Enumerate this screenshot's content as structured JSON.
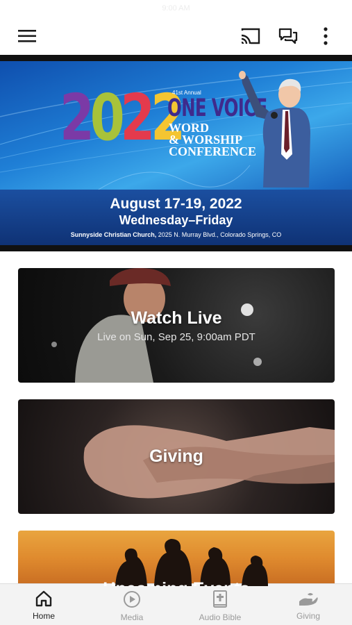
{
  "status_bar": {
    "time": "9:00 AM"
  },
  "app_bar": {
    "menu_icon": "hamburger-menu-icon",
    "cast_icon": "cast-icon",
    "chat_icon": "chat-bubbles-icon",
    "more_icon": "more-vertical-icon"
  },
  "banner": {
    "year": "2022",
    "annual": "41st Annual",
    "name": "ONE VOICE",
    "line1": "WORD",
    "line2": "& WORSHIP",
    "line3": "CONFERENCE",
    "dates": "August 17-19, 2022",
    "days": "Wednesday–Friday",
    "venue_name": "Sunnyside Christian Church,",
    "venue_address": " 2025 N. Murray Blvd., Colorado Springs, CO"
  },
  "cards": [
    {
      "title": "Watch Live",
      "subtitle": "Live on Sun, Sep 25, 9:00am PDT"
    },
    {
      "title": "Giving"
    },
    {
      "title": "Upcoming Events"
    }
  ],
  "tabs": [
    {
      "label": "Home",
      "icon": "home-icon",
      "active": true
    },
    {
      "label": "Media",
      "icon": "play-circle-icon",
      "active": false
    },
    {
      "label": "Audio Bible",
      "icon": "bible-icon",
      "active": false
    },
    {
      "label": "Giving",
      "icon": "giving-hand-icon",
      "active": false
    }
  ],
  "colors": {
    "active_tab": "#1f1f1f",
    "inactive_tab": "#9a9a9a",
    "year_2": "#7b3aa6",
    "year_0": "#a8c23a",
    "year_2b": "#e43a4d",
    "year_2c": "#f4c531",
    "brand_name": "#3f2a8c"
  }
}
